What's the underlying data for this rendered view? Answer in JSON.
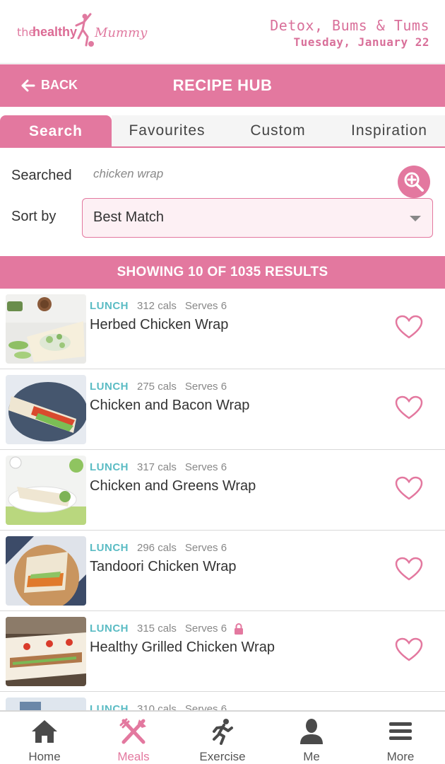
{
  "header": {
    "logo_text_1": "the",
    "logo_text_2": "healthy",
    "logo_text_3": "Mummy",
    "plan_name": "Detox, Bums & Tums",
    "plan_date": "Tuesday, January 22"
  },
  "titlebar": {
    "back_label": "BACK",
    "title": "RECIPE HUB"
  },
  "tabs": [
    {
      "label": "Search",
      "active": true
    },
    {
      "label": "Favourites",
      "active": false
    },
    {
      "label": "Custom",
      "active": false
    },
    {
      "label": "Inspiration",
      "active": false
    }
  ],
  "search": {
    "searched_label": "Searched",
    "searched_value": "chicken wrap",
    "sort_label": "Sort by",
    "sort_value": "Best Match"
  },
  "results_text": "SHOWING 10 OF 1035 RESULTS",
  "recipes": [
    {
      "category": "LUNCH",
      "cals": "312 cals",
      "serves": "Serves 6",
      "name": "Herbed Chicken Wrap",
      "locked": false
    },
    {
      "category": "LUNCH",
      "cals": "275 cals",
      "serves": "Serves 6",
      "name": "Chicken and Bacon Wrap",
      "locked": false
    },
    {
      "category": "LUNCH",
      "cals": "317 cals",
      "serves": "Serves 6",
      "name": "Chicken and Greens Wrap",
      "locked": false
    },
    {
      "category": "LUNCH",
      "cals": "296 cals",
      "serves": "Serves 6",
      "name": "Tandoori Chicken Wrap",
      "locked": false
    },
    {
      "category": "LUNCH",
      "cals": "315 cals",
      "serves": "Serves 6",
      "name": "Healthy Grilled Chicken Wrap",
      "locked": true
    },
    {
      "category": "LUNCH",
      "cals": "310 cals",
      "serves": "Serves 6",
      "name": "",
      "locked": false
    }
  ],
  "bottom_nav": [
    {
      "label": "Home",
      "icon": "home-icon",
      "active": false
    },
    {
      "label": "Meals",
      "icon": "fork-knife-icon",
      "active": true
    },
    {
      "label": "Exercise",
      "icon": "running-person-icon",
      "active": false
    },
    {
      "label": "Me",
      "icon": "person-icon",
      "active": false
    },
    {
      "label": "More",
      "icon": "hamburger-menu-icon",
      "active": false
    }
  ],
  "colors": {
    "brand_pink": "#e3789f",
    "category_teal": "#5bbcc4"
  }
}
